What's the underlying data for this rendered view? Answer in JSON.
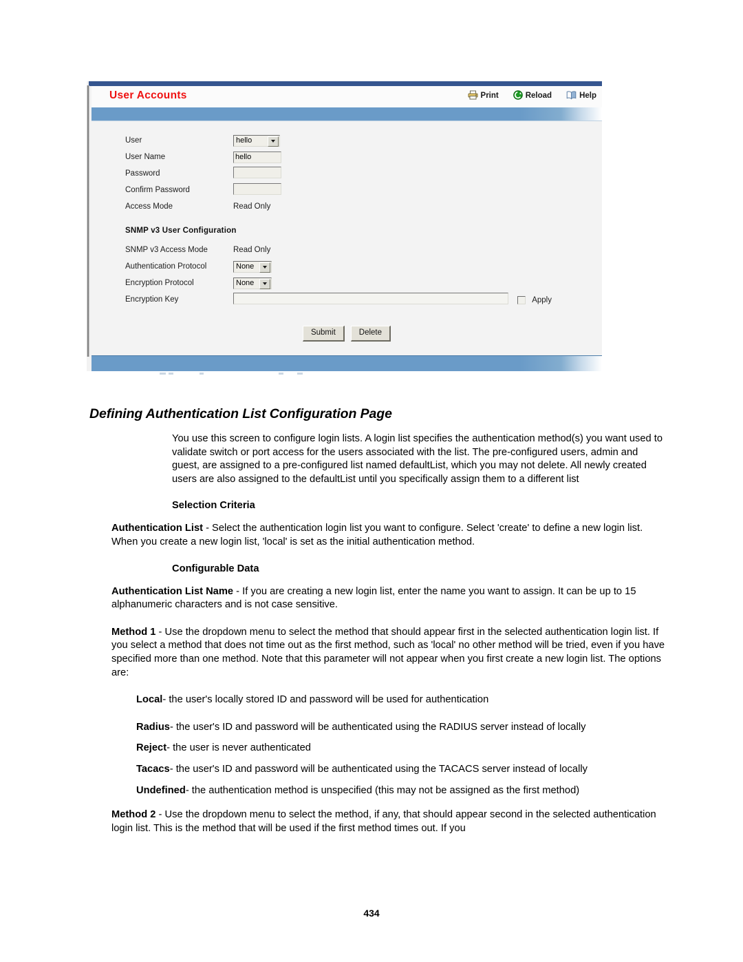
{
  "screenshot": {
    "title": "User Accounts",
    "title_color": "#ef1111",
    "accent_band_color": "#6a9bc8",
    "top_border_color": "#35558f",
    "toolbar": [
      {
        "label": "Print",
        "icon": "printer-icon"
      },
      {
        "label": "Reload",
        "icon": "reload-icon"
      },
      {
        "label": "Help",
        "icon": "help-book-icon"
      }
    ],
    "form": {
      "user": {
        "label": "User",
        "value": "hello",
        "type": "select"
      },
      "user_name": {
        "label": "User Name",
        "value": "hello",
        "type": "text"
      },
      "password": {
        "label": "Password",
        "value": "",
        "type": "text"
      },
      "confirm_password": {
        "label": "Confirm Password",
        "value": "",
        "type": "text"
      },
      "access_mode": {
        "label": "Access Mode",
        "value": "Read Only",
        "type": "readonly"
      }
    },
    "snmp": {
      "heading": "SNMP v3 User Configuration",
      "access_mode": {
        "label": "SNMP v3 Access Mode",
        "value": "Read Only",
        "type": "readonly"
      },
      "auth_protocol": {
        "label": "Authentication Protocol",
        "value": "None",
        "type": "select"
      },
      "enc_protocol": {
        "label": "Encryption Protocol",
        "value": "None",
        "type": "select"
      },
      "enc_key": {
        "label": "Encryption Key",
        "value": "",
        "type": "text"
      },
      "apply": {
        "label": "Apply",
        "checked": false
      }
    },
    "buttons": {
      "submit": "Submit",
      "delete": "Delete"
    }
  },
  "document": {
    "heading": "Defining Authentication List Configuration Page",
    "intro": "You use this screen to configure login lists. A login list specifies the authentication method(s) you want used to validate switch or port access for the users associated with the list. The pre-configured users, admin and guest, are assigned to a pre-configured list named defaultList, which you may not delete. All newly created users are also assigned to the defaultList until you specifically assign them to a different list",
    "selection_criteria_heading": "Selection Criteria",
    "auth_list_term": "Authentication List",
    "auth_list_desc": " - Select the authentication login list you want to configure. Select 'create' to define a new login list. When you create a new login list, 'local' is set as the initial authentication method.",
    "configurable_data_heading": "Configurable Data",
    "auth_list_name_term": "Authentication List Name",
    "auth_list_name_desc": " - If you are creating a new login list, enter the name you want to assign. It can be up to 15 alphanumeric characters and is not case sensitive.",
    "method1_term": "Method 1",
    "method1_desc": " - Use the dropdown menu to select the method that should appear first in the selected authentication login list. If you select a method that does not time out as the first method, such as 'local' no other method will be tried, even if you have specified more than one method. Note that this parameter will not appear when you first create a new login list. The options are:",
    "options": [
      {
        "term": "Local",
        "desc": "- the user's locally stored ID and password will be used for authentication"
      },
      {
        "term": "Radius",
        "desc": "- the user's ID and password will be authenticated using the RADIUS server instead of locally"
      },
      {
        "term": "Reject",
        "desc": "- the user is never authenticated"
      },
      {
        "term": "Tacacs",
        "desc": "- the user's ID and password will be authenticated using the TACACS server instead of locally"
      },
      {
        "term": "Undefined",
        "desc": "- the authentication method is unspecified (this may not be assigned as the first method)"
      }
    ],
    "method2_term": "Method 2",
    "method2_desc": " - Use the dropdown menu to select the method, if any, that should appear second in the selected authentication login list. This is the method that will be used if the first method times out. If you",
    "page_number": "434"
  }
}
